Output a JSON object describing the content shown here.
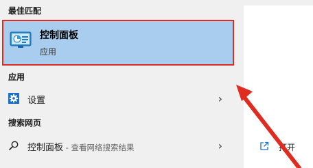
{
  "sections": {
    "best_match": "最佳匹配",
    "apps": "应用",
    "web": "搜索网页"
  },
  "best_match_item": {
    "title": "控制面板",
    "subtitle": "应用",
    "icon": "control-panel-icon"
  },
  "app_items": [
    {
      "label": "设置",
      "icon": "gear-icon"
    }
  ],
  "web_item": {
    "query": "控制面板",
    "suffix": " - 查看网络搜索结果",
    "icon": "search-icon"
  },
  "right_panel": {
    "open_label": "打开",
    "open_icon": "open-icon"
  },
  "colors": {
    "highlight": "#a9cdee",
    "outline": "#e02b20",
    "arrow": "#e02b20",
    "settings_icon": "#1a6fc9"
  }
}
